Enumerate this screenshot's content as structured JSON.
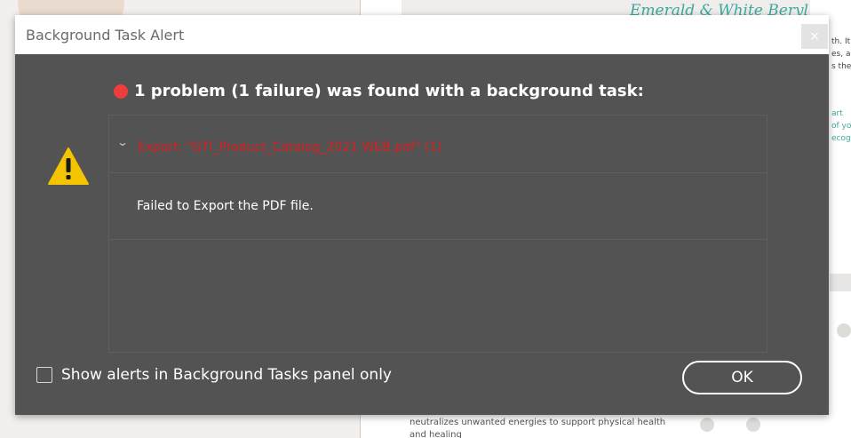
{
  "background": {
    "heading": "Emerald & White Beryl",
    "side_snippets": [
      {
        "text": "th. It",
        "top": 0
      },
      {
        "text": "es, an",
        "top": 0
      },
      {
        "text": "s the",
        "top": 0
      }
    ],
    "side_links": [
      "art",
      "of yo",
      "ecogn"
    ],
    "bottom_lines": [
      "neutralizes unwanted energies to support physical health",
      "and healing"
    ]
  },
  "dialog": {
    "title": "Background Task Alert",
    "close_label": "×",
    "headline": "1 problem (1 failure) was found with a background task:",
    "task": {
      "name": "Export: \"GTI_Product_Catalog_2021 WEB.pdf\" (1)",
      "message": "Failed to Export the PDF file."
    },
    "checkbox_label": "Show alerts in Background Tasks panel only",
    "checkbox_checked": false,
    "ok_label": "OK"
  },
  "colors": {
    "dialog_bg": "#535353",
    "error_red": "#d82020",
    "dot_red": "#ef3d3d",
    "warning_yellow": "#f5c400",
    "accent_teal": "#3ea9a0"
  },
  "icons": {
    "warning": "warning-triangle-icon",
    "status": "error-dot-icon",
    "expand": "chevron-down-icon"
  }
}
